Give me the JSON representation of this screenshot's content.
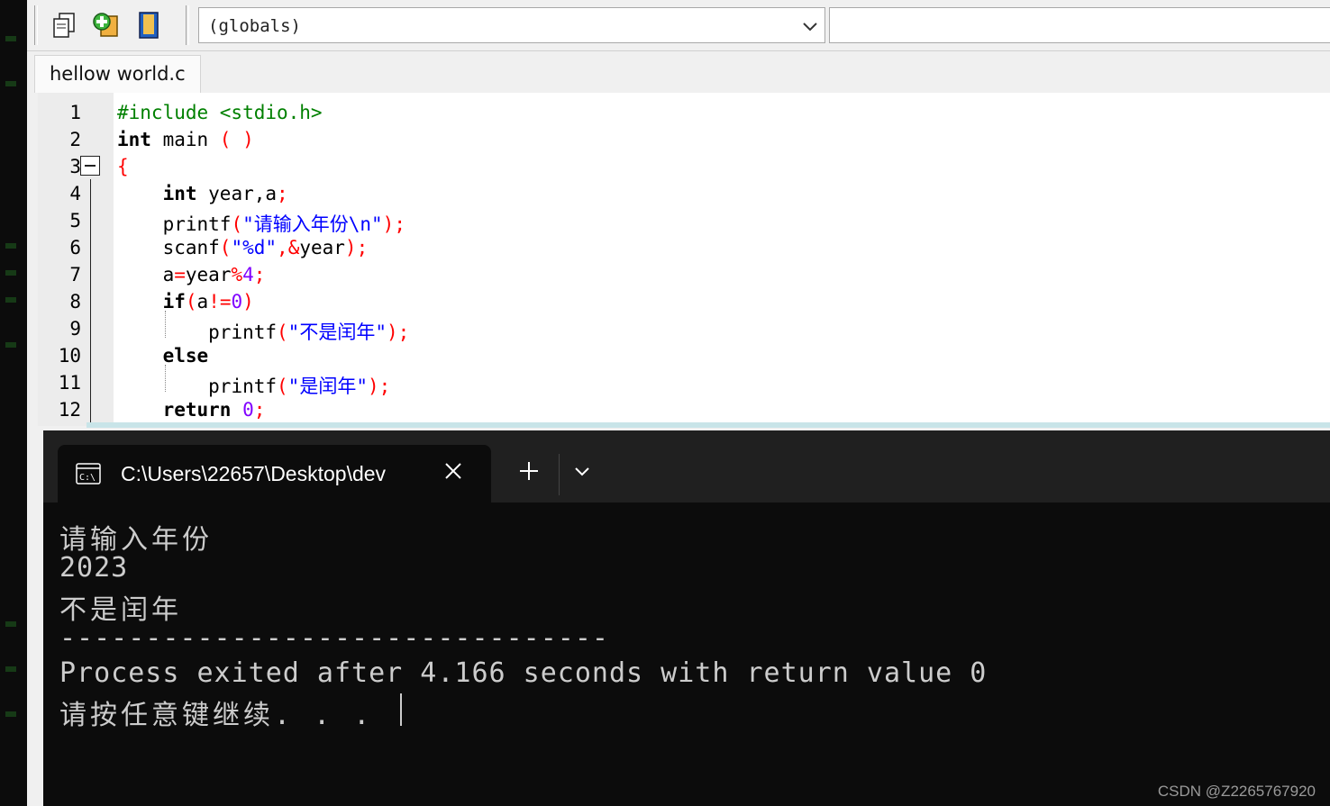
{
  "toolbar": {
    "globals_value": "(globals)",
    "icons": [
      "copy-icon",
      "add-file-icon",
      "bookmark-icon",
      "chevron-down-icon"
    ]
  },
  "editor": {
    "tab_label": "hellow world.c",
    "line_numbers": [
      "1",
      "2",
      "3",
      "4",
      "5",
      "6",
      "7",
      "8",
      "9",
      "10",
      "11",
      "12"
    ],
    "code_lines": [
      "#include <stdio.h>",
      "int main ( )",
      "{",
      "    int year,a;",
      "    printf(\"请输入年份\\n\");",
      "    scanf(\"%d\",&year);",
      "    a=year%4;",
      "    if(a!=0)",
      "        printf(\"不是闰年\");",
      "    else",
      "        printf(\"是闰年\");",
      "    return 0;"
    ],
    "tokens": {
      "include": "#include <stdio.h>",
      "int": "int",
      "main": " main ",
      "paren_open": "(",
      "paren_close": ")",
      "brace": "{",
      "year_a": " year,a",
      "semi": ";",
      "printf": "printf",
      "lp": "(",
      "rp": ")",
      "str1": "\"请输入年份\\n\"",
      "scanf": "scanf",
      "fmt": "\"%d\"",
      "comma": ",",
      "amp": "&",
      "year": "year",
      "a": "a",
      "eq": "=",
      "mod": "%",
      "four": "4",
      "if": "if",
      "neq": "!=",
      "zero": "0",
      "str2": "\"不是闰年\"",
      "else": "else",
      "str3": "\"是闰年\"",
      "return": "return"
    }
  },
  "terminal": {
    "title": "C:\\Users\\22657\\Desktop\\dev",
    "icon": "console-icon",
    "lines": [
      "请输入年份",
      "2023",
      "不是闰年",
      "--------------------------------",
      "Process exited after 4.166 seconds with return value 0",
      "请按任意键继续. . ."
    ]
  },
  "watermark": "CSDN @Z2265767920"
}
